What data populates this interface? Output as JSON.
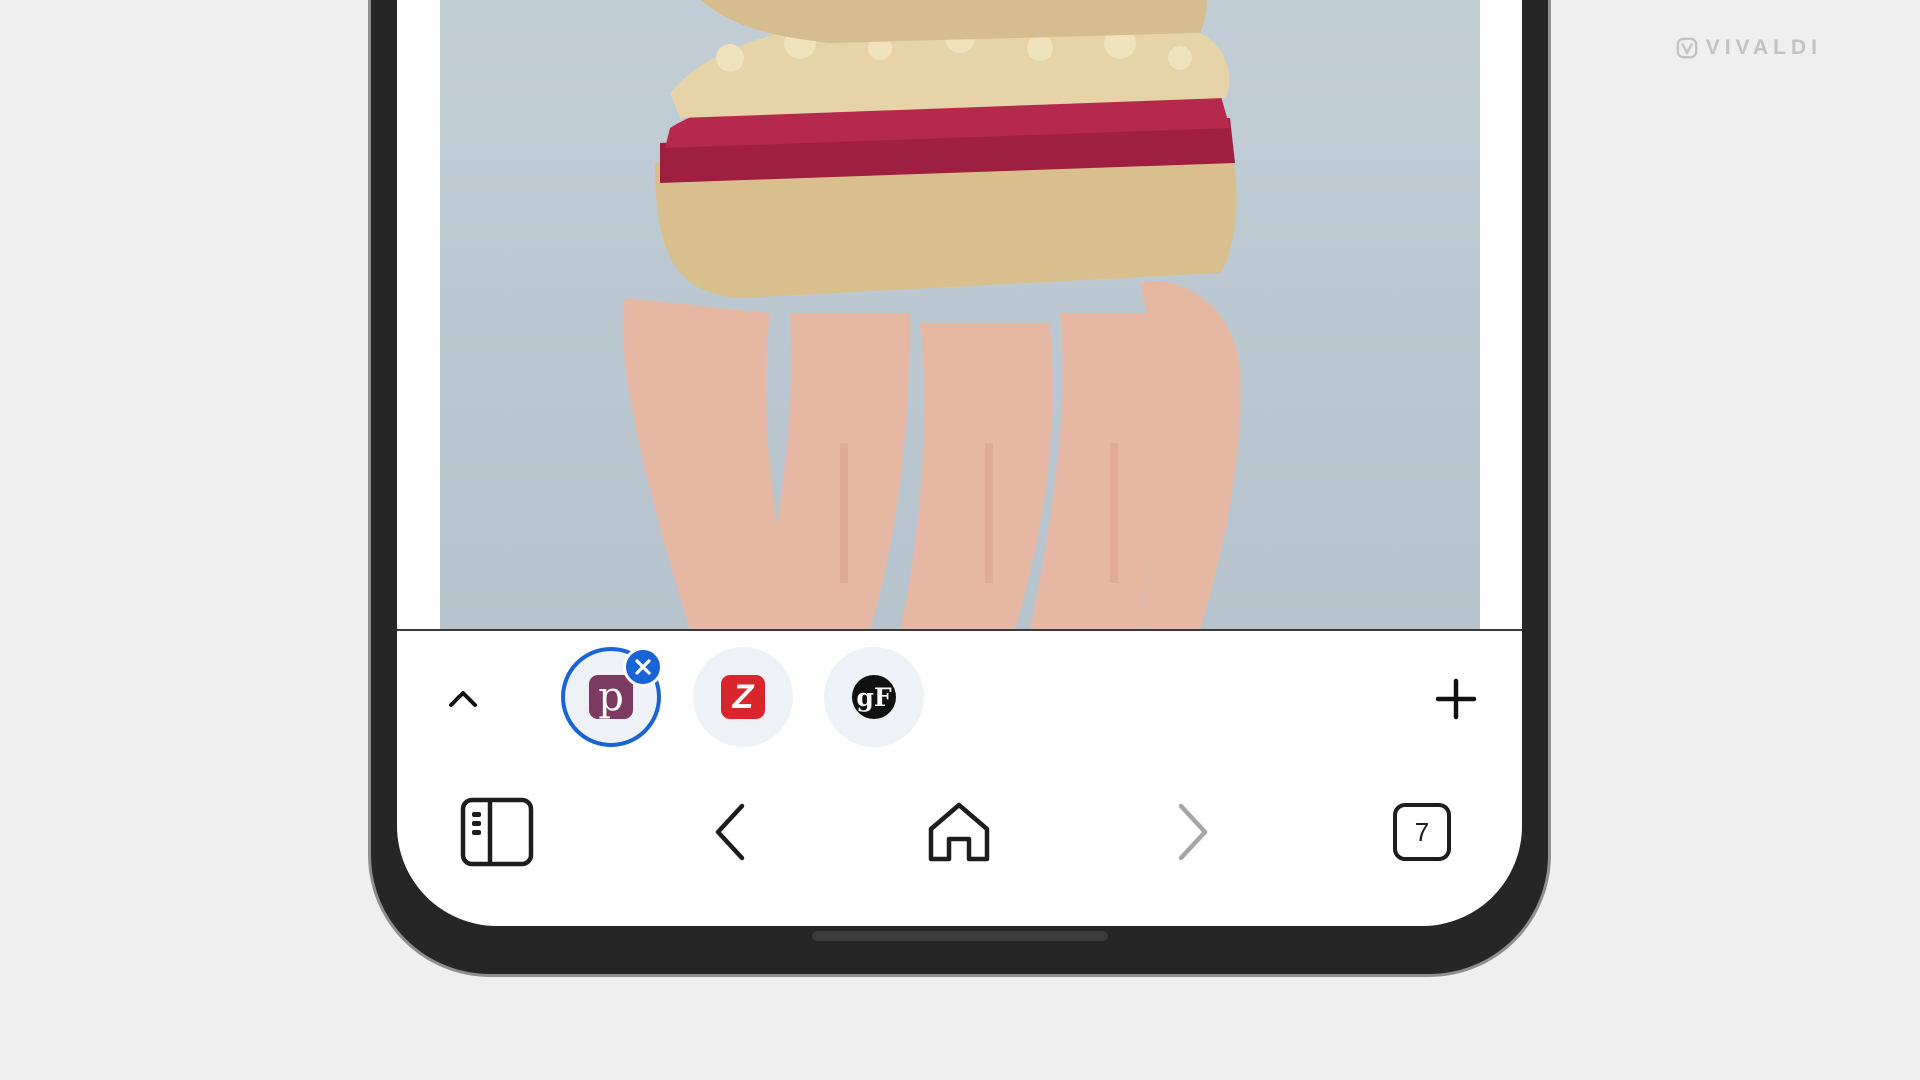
{
  "watermark": {
    "brand": "VIVALDI",
    "icon": "vivaldi-logo-icon"
  },
  "content": {
    "image": "raspberry-crumble-bars-photo"
  },
  "tab_stack_panel": {
    "collapse_icon": "chevron-up-icon",
    "new_tab_icon": "plus-icon",
    "tabs": [
      {
        "favicon_text": "p",
        "active": true,
        "color": "#7a3a62"
      },
      {
        "favicon_text": "Z",
        "active": false,
        "color": "#d8262c"
      },
      {
        "favicon_text": "gF",
        "active": false,
        "color": "#111111"
      }
    ],
    "close_icon": "close-icon"
  },
  "bottom_toolbar": {
    "panels_icon": "panel-toggle-icon",
    "back_icon": "back-arrow-icon",
    "home_icon": "home-icon",
    "forward_icon": "forward-arrow-icon",
    "tab_count": "7"
  },
  "colors": {
    "accent": "#1a63d6",
    "background": "#efefef",
    "phone_frame": "#262626"
  }
}
